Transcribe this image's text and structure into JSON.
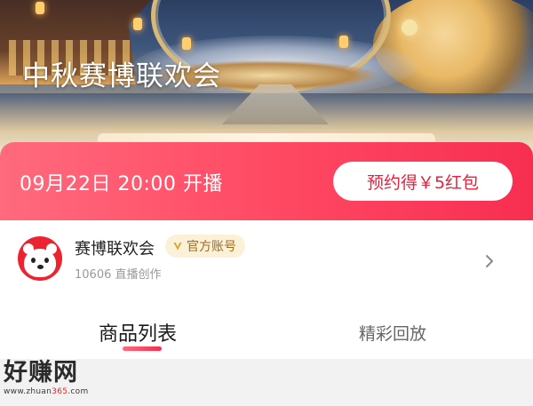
{
  "hero": {
    "title": "中秋赛博联欢会"
  },
  "live": {
    "time_text": "09月22日 20:00 开播",
    "reserve_label": "预约得￥5红包"
  },
  "account": {
    "name": "赛博联欢会",
    "badge": "官方账号",
    "subtitle": "10606 直播创作"
  },
  "tabs": [
    {
      "label": "商品列表",
      "active": true
    },
    {
      "label": "精彩回放",
      "active": false
    }
  ],
  "watermark": {
    "title": "好赚网",
    "url_prefix": "www.zhuan",
    "url_highlight": "365",
    "url_suffix": ".com"
  },
  "colors": {
    "accent": "#f72e50",
    "accent_light": "#ff6a7d",
    "badge_bg": "#fbf1d9",
    "badge_text": "#a06a1c"
  },
  "icons": {
    "badge": "v-verified-icon",
    "chevron": "chevron-right-icon",
    "avatar": "dog-mascot-avatar"
  }
}
